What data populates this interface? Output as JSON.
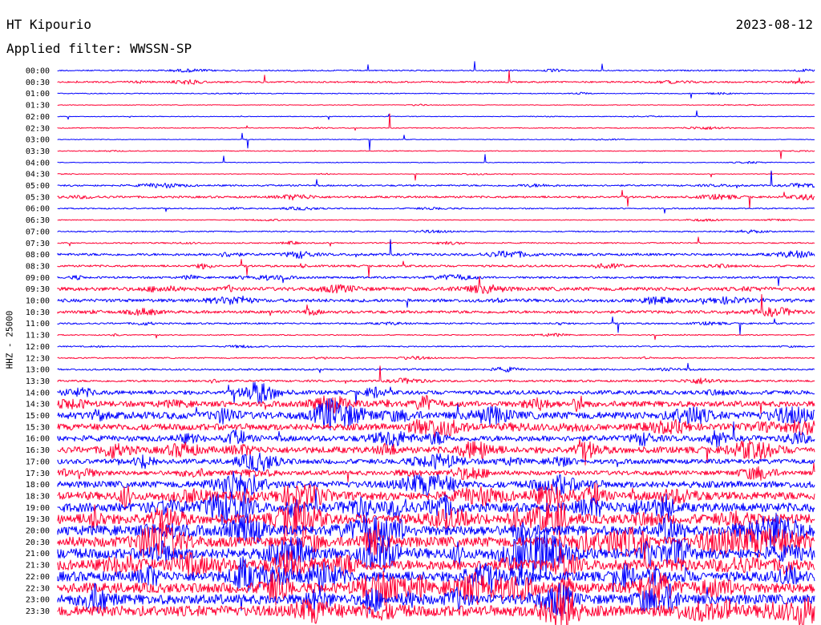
{
  "header": {
    "station": "HT Kipourio",
    "date": "2023-08-12",
    "filter": "Applied filter: WWSSN-SP"
  },
  "chart_data": {
    "type": "line",
    "subtype": "helicorder",
    "ylabel": "HHZ - 25000",
    "colors": [
      "#0000ff",
      "#ff0033"
    ],
    "rows": [
      {
        "time": "00:00",
        "color": "#0000ff",
        "level": 0.15
      },
      {
        "time": "00:30",
        "color": "#ff0033",
        "level": 0.2
      },
      {
        "time": "01:00",
        "color": "#0000ff",
        "level": 0.1
      },
      {
        "time": "01:30",
        "color": "#ff0033",
        "level": 0.08
      },
      {
        "time": "02:00",
        "color": "#0000ff",
        "level": 0.08
      },
      {
        "time": "02:30",
        "color": "#ff0033",
        "level": 0.1
      },
      {
        "time": "03:00",
        "color": "#0000ff",
        "level": 0.08
      },
      {
        "time": "03:30",
        "color": "#ff0033",
        "level": 0.1
      },
      {
        "time": "04:00",
        "color": "#0000ff",
        "level": 0.08
      },
      {
        "time": "04:30",
        "color": "#ff0033",
        "level": 0.08
      },
      {
        "time": "05:00",
        "color": "#0000ff",
        "level": 0.2
      },
      {
        "time": "05:30",
        "color": "#ff0033",
        "level": 0.25
      },
      {
        "time": "06:00",
        "color": "#0000ff",
        "level": 0.15
      },
      {
        "time": "06:30",
        "color": "#ff0033",
        "level": 0.1
      },
      {
        "time": "07:00",
        "color": "#0000ff",
        "level": 0.15
      },
      {
        "time": "07:30",
        "color": "#ff0033",
        "level": 0.15
      },
      {
        "time": "08:00",
        "color": "#0000ff",
        "level": 0.3
      },
      {
        "time": "08:30",
        "color": "#ff0033",
        "level": 0.25
      },
      {
        "time": "09:00",
        "color": "#0000ff",
        "level": 0.25
      },
      {
        "time": "09:30",
        "color": "#ff0033",
        "level": 0.45
      },
      {
        "time": "10:00",
        "color": "#0000ff",
        "level": 0.4
      },
      {
        "time": "10:30",
        "color": "#ff0033",
        "level": 0.35
      },
      {
        "time": "11:00",
        "color": "#0000ff",
        "level": 0.2
      },
      {
        "time": "11:30",
        "color": "#ff0033",
        "level": 0.12
      },
      {
        "time": "12:00",
        "color": "#0000ff",
        "level": 0.15
      },
      {
        "time": "12:30",
        "color": "#ff0033",
        "level": 0.15
      },
      {
        "time": "13:00",
        "color": "#0000ff",
        "level": 0.2
      },
      {
        "time": "13:30",
        "color": "#ff0033",
        "level": 0.25
      },
      {
        "time": "14:00",
        "color": "#0000ff",
        "level": 0.5
      },
      {
        "time": "14:30",
        "color": "#ff0033",
        "level": 0.7
      },
      {
        "time": "15:00",
        "color": "#0000ff",
        "level": 0.9
      },
      {
        "time": "15:30",
        "color": "#ff0033",
        "level": 0.8
      },
      {
        "time": "16:00",
        "color": "#0000ff",
        "level": 0.7
      },
      {
        "time": "16:30",
        "color": "#ff0033",
        "level": 0.8
      },
      {
        "time": "17:00",
        "color": "#0000ff",
        "level": 0.6
      },
      {
        "time": "17:30",
        "color": "#ff0033",
        "level": 0.55
      },
      {
        "time": "18:00",
        "color": "#0000ff",
        "level": 0.8
      },
      {
        "time": "18:30",
        "color": "#ff0033",
        "level": 1.0
      },
      {
        "time": "19:00",
        "color": "#0000ff",
        "level": 1.1
      },
      {
        "time": "19:30",
        "color": "#ff0033",
        "level": 1.2
      },
      {
        "time": "20:00",
        "color": "#0000ff",
        "level": 1.2
      },
      {
        "time": "20:30",
        "color": "#ff0033",
        "level": 1.25
      },
      {
        "time": "21:00",
        "color": "#0000ff",
        "level": 1.25
      },
      {
        "time": "21:30",
        "color": "#ff0033",
        "level": 1.25
      },
      {
        "time": "22:00",
        "color": "#0000ff",
        "level": 1.2
      },
      {
        "time": "22:30",
        "color": "#ff0033",
        "level": 1.25
      },
      {
        "time": "23:00",
        "color": "#0000ff",
        "level": 1.2
      },
      {
        "time": "23:30",
        "color": "#ff0033",
        "level": 1.3
      }
    ]
  }
}
